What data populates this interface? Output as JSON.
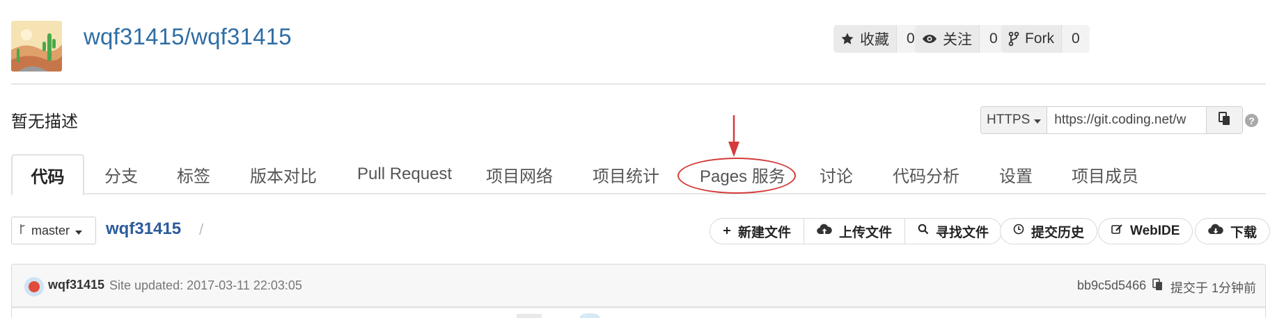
{
  "repo": {
    "title": "wqf31415/wqf31415",
    "description": "暂无描述"
  },
  "social": {
    "star": {
      "label": "收藏",
      "count": "0",
      "icon": "star-icon"
    },
    "watch": {
      "label": "关注",
      "count": "0",
      "icon": "eye-icon"
    },
    "fork": {
      "label": "Fork",
      "count": "0",
      "icon": "fork-icon"
    }
  },
  "clone": {
    "protocol": "HTTPS",
    "url": "https://git.coding.net/w",
    "help": "?"
  },
  "tabs": [
    {
      "label": "代码",
      "active": true
    },
    {
      "label": "分支"
    },
    {
      "label": "标签"
    },
    {
      "label": "版本对比"
    },
    {
      "label": "Pull Request"
    },
    {
      "label": "项目网络"
    },
    {
      "label": "项目统计"
    },
    {
      "label": "Pages 服务"
    },
    {
      "label": "讨论"
    },
    {
      "label": "代码分析"
    },
    {
      "label": "设置"
    },
    {
      "label": "项目成员"
    }
  ],
  "annotation": {
    "color": "#d43a3a"
  },
  "branch": {
    "name": "master"
  },
  "path": {
    "root": "wqf31415",
    "separator": "/"
  },
  "actions": {
    "new_file": "新建文件",
    "upload_file": "上传文件",
    "find_file": "寻找文件",
    "history": "提交历史",
    "webide": "WebIDE",
    "download": "下载"
  },
  "commit": {
    "user": "wqf31415",
    "message": "Site updated: 2017-03-11 22:03:05",
    "hash": "bb9c5d5466",
    "time": "提交于 1分钟前"
  },
  "colors": {
    "link": "#2e6da4",
    "path": "#2b5b9b"
  }
}
